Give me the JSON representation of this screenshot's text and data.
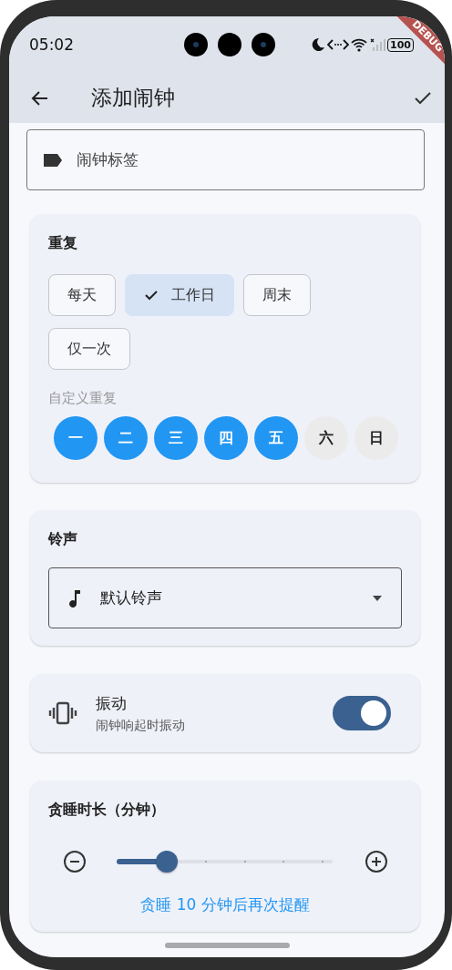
{
  "status_bar": {
    "time": "05:02",
    "battery": "100"
  },
  "debug_banner": "DEBUG",
  "app_bar": {
    "title": "添加闹钟"
  },
  "label_field": {
    "placeholder": "闹钟标签"
  },
  "repeat": {
    "title": "重复",
    "presets": [
      {
        "label": "每天",
        "selected": false
      },
      {
        "label": "工作日",
        "selected": true
      },
      {
        "label": "周末",
        "selected": false
      },
      {
        "label": "仅一次",
        "selected": false
      }
    ],
    "custom_label": "自定义重复",
    "days": [
      {
        "label": "一",
        "selected": true
      },
      {
        "label": "二",
        "selected": true
      },
      {
        "label": "三",
        "selected": true
      },
      {
        "label": "四",
        "selected": true
      },
      {
        "label": "五",
        "selected": true
      },
      {
        "label": "六",
        "selected": false
      },
      {
        "label": "日",
        "selected": false
      }
    ]
  },
  "ringtone": {
    "title": "铃声",
    "value": "默认铃声"
  },
  "vibration": {
    "title": "振动",
    "subtitle": "闹钟响起时振动",
    "on": true
  },
  "snooze": {
    "title": "贪睡时长（分钟）",
    "level": 0.2,
    "caption": "贪睡 10 分钟后再次提醒"
  }
}
